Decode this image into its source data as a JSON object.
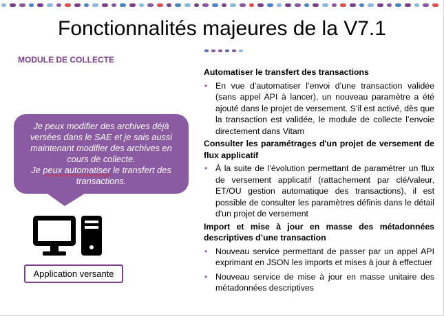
{
  "slide": {
    "title": "Fonctionnalités majeures de la V7.1",
    "module_label": "MODULE DE COLLECTE"
  },
  "bubble": {
    "line1": "Je peux modifier des archives déjà versées dans le SAE et je sais aussi maintenant modifier des archives en cours de collecte.",
    "line2_a": "Je ",
    "line2_underlined": "peux automatiser",
    "line2_b": " le transfert des transactions."
  },
  "icon_label": "Application versante",
  "sections": [
    {
      "heading": "Automatiser le transfert des transactions",
      "items": [
        "En vue d’automatiser l’envoi d’une transaction validée (sans appel API à lancer), un nouveau paramètre a été ajouté dans le projet de versement. S’il est activé, dès que la transaction est validée, le module de collecte l’envoie directement dans Vitam"
      ]
    },
    {
      "heading": "Consulter les paramétrages d'un projet de versement de flux applicatif",
      "items": [
        "À la suite de l’évolution permettant de paramétrer un flux de versement applicatif (rattachement par clé/valeur, ET/OU gestion automatique des transactions), il est possible de consulter les paramètres définis dans le détail d'un projet de versement"
      ]
    },
    {
      "heading": "Import et mise à jour en masse des métadonnées descriptives d’une transaction",
      "items": [
        "Nouveau service permettant de passer par un appel API exprimant en JSON les imports et mises à jour à effectuer",
        "Nouveau service de mise à jour en masse unitaire des métadonnées descriptives"
      ]
    }
  ],
  "colors": {
    "purple": "#8a5aa2",
    "dark_purple": "#7b3f8c",
    "light_blue": "#8cb8e0",
    "blue": "#4a86c8",
    "red": "#e05050"
  },
  "icons": [
    "computer-icon",
    "bullet-icon"
  ]
}
